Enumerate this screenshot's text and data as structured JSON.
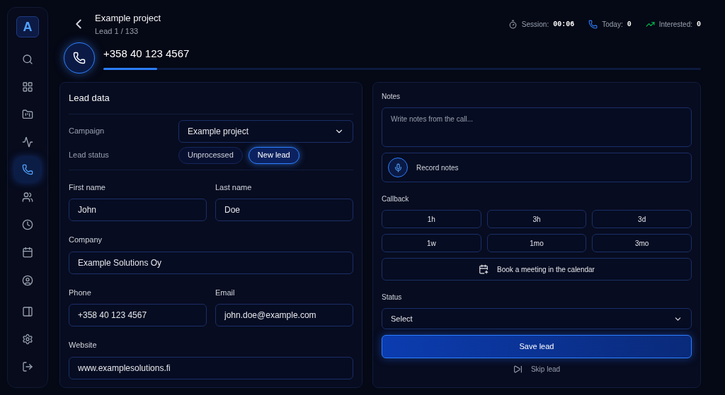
{
  "sidebar": {
    "logo": "A",
    "items": [
      {
        "kind": "search",
        "selected": false
      },
      {
        "kind": "grid",
        "selected": false
      },
      {
        "kind": "folder",
        "selected": false
      },
      {
        "kind": "activity",
        "selected": false
      },
      {
        "kind": "phone",
        "selected": true
      },
      {
        "kind": "users",
        "selected": false
      },
      {
        "kind": "clock",
        "selected": false
      },
      {
        "kind": "calendar",
        "selected": false
      },
      {
        "kind": "account",
        "selected": false
      }
    ],
    "bottom_items": [
      {
        "kind": "panel"
      },
      {
        "kind": "settings"
      },
      {
        "kind": "logout"
      }
    ]
  },
  "header": {
    "title": "Example project",
    "subtitle": "Lead 1 / 133",
    "phone": "+358 40 123 4567",
    "progress": {
      "level": 0.09
    },
    "stats": [
      {
        "kind": "timer",
        "label": "Session:",
        "value": "00:06"
      },
      {
        "kind": "phone",
        "label": "Today:",
        "value": "0"
      },
      {
        "kind": "trend",
        "label": "Interested:",
        "value": "0"
      }
    ]
  },
  "lead_data": {
    "title": "Lead data",
    "campaign": {
      "label": "Campaign",
      "value": "Example project"
    },
    "lead_status": {
      "label": "Lead status",
      "options": [
        {
          "label": "Unprocessed",
          "selected": false
        },
        {
          "label": "New lead",
          "selected": true
        }
      ]
    },
    "fields": [
      {
        "label": "First name",
        "value": "John",
        "kind": "half"
      },
      {
        "label": "Last name",
        "value": "Doe",
        "kind": "half"
      },
      {
        "label": "Company",
        "value": "Example Solutions Oy",
        "kind": "full"
      },
      {
        "label": "Phone",
        "value": "+358 40 123 4567",
        "kind": "half"
      },
      {
        "label": "Email",
        "value": "john.doe@example.com",
        "kind": "half"
      },
      {
        "label": "Website",
        "value": "www.examplesolutions.fi",
        "kind": "full"
      }
    ]
  },
  "notes": {
    "label": "Notes",
    "placeholder": "Write notes from the call...",
    "record": "Record notes"
  },
  "callback": {
    "label": "Callback",
    "options": [
      "1h",
      "3h",
      "3d",
      "1w",
      "1mo",
      "3mo"
    ],
    "book": "Book a meeting in the calendar"
  },
  "status": {
    "label": "Status",
    "value": "Select"
  },
  "actions": {
    "save": "Save lead",
    "skip": "Skip lead"
  }
}
